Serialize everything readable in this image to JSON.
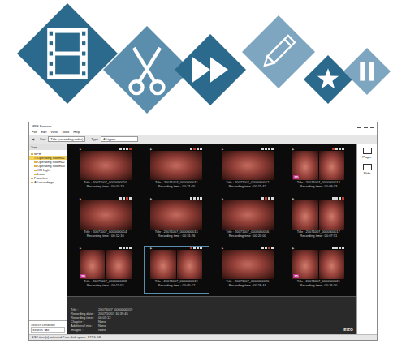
{
  "banner": {
    "icons": [
      {
        "kind": "film",
        "color": "#2b6a8c"
      },
      {
        "kind": "scissors",
        "color": "#5b8ead"
      },
      {
        "kind": "fast-forward",
        "color": "#2b6a8c"
      },
      {
        "kind": "pencil",
        "color": "#7fa6c1"
      },
      {
        "kind": "star",
        "color": "#2b6a8c"
      },
      {
        "kind": "pause",
        "color": "#7fa6c1"
      }
    ]
  },
  "window": {
    "title": "MPE Browser"
  },
  "menu": [
    "File",
    "Edit",
    "View",
    "Tools",
    "Help"
  ],
  "toolbar": {
    "back": "◀",
    "sort_label": "Sort",
    "sort_value": "Title (ascending order)",
    "filter_label": "Type",
    "filter_value": "All types"
  },
  "sidebar": {
    "header": "Tree",
    "items": [
      {
        "label": "MPE",
        "depth": 0,
        "selected": false
      },
      {
        "label": "Operating Room01",
        "depth": 1,
        "selected": true
      },
      {
        "label": "Operating Room02",
        "depth": 1,
        "selected": false
      },
      {
        "label": "Operating Room03",
        "depth": 1,
        "selected": false
      },
      {
        "label": "OR Light",
        "depth": 1,
        "selected": false
      },
      {
        "label": "Laser",
        "depth": 1,
        "selected": false
      },
      {
        "label": "Favorites",
        "depth": 0,
        "selected": false
      },
      {
        "label": "All recordings",
        "depth": 0,
        "selected": false
      }
    ],
    "search_label": "Search condition",
    "search_value": "Search : All"
  },
  "grid": {
    "marker": "▶",
    "thumbnails": [
      {
        "kind": "single",
        "badge": "",
        "selected": false,
        "title": "Title : 20071007_0000000010",
        "time": "Recording time : 00:07:18",
        "tags": [
          {
            "color": "#d9d9d9"
          },
          {
            "color": "#d9d9d9"
          },
          {
            "color": "#d9d9d9"
          },
          {
            "color": "#c0392b"
          }
        ]
      },
      {
        "kind": "single",
        "badge": "",
        "selected": false,
        "title": "Title : 20071007_0000000011",
        "time": "Recording time : 00:21:05",
        "tags": [
          {
            "color": "#d9d9d9"
          },
          {
            "color": "#c0392b"
          },
          {
            "color": "#d9d9d9"
          },
          {
            "color": "#d9d9d9"
          }
        ]
      },
      {
        "kind": "single",
        "badge": "",
        "selected": false,
        "title": "Title : 20071007_0000000012",
        "time": "Recording time : 00:15:42",
        "tags": [
          {
            "color": "#d9d9d9"
          },
          {
            "color": "#d9d9d9"
          },
          {
            "color": "#d9d9d9"
          },
          {
            "color": "#d9d9d9"
          }
        ]
      },
      {
        "kind": "dual",
        "badge": "3D",
        "selected": false,
        "title": "Title : 20071007_0000000013",
        "time": "Recording time : 00:09:33",
        "tags": [
          {
            "color": "#c0392b"
          },
          {
            "color": "#d9d9d9"
          },
          {
            "color": "#d9d9d9"
          },
          {
            "color": "#d9d9d9"
          }
        ]
      },
      {
        "kind": "single",
        "badge": "",
        "selected": false,
        "title": "Title : 20071007_0000000014",
        "time": "Recording time : 00:12:10",
        "tags": [
          {
            "color": "#d9d9d9"
          },
          {
            "color": "#d9d9d9"
          },
          {
            "color": "#c0392b"
          },
          {
            "color": "#d9d9d9"
          }
        ]
      },
      {
        "kind": "single",
        "badge": "",
        "selected": false,
        "title": "Title : 20071007_0000000015",
        "time": "Recording time : 00:31:26",
        "tags": [
          {
            "color": "#d9d9d9"
          },
          {
            "color": "#d9d9d9"
          },
          {
            "color": "#d9d9d9"
          },
          {
            "color": "#d9d9d9"
          }
        ]
      },
      {
        "kind": "single",
        "badge": "",
        "selected": false,
        "title": "Title : 20071007_0000000016",
        "time": "Recording time : 00:20:00",
        "tags": [
          {
            "color": "#d9d9d9"
          },
          {
            "color": "#c0392b"
          },
          {
            "color": "#d9d9d9"
          },
          {
            "color": "#d9d9d9"
          }
        ]
      },
      {
        "kind": "dual",
        "badge": "",
        "selected": false,
        "title": "Title : 20071007_0000000017",
        "time": "Recording time : 00:07:51",
        "tags": [
          {
            "color": "#d9d9d9"
          },
          {
            "color": "#d9d9d9"
          },
          {
            "color": "#d9d9d9"
          },
          {
            "color": "#c0392b"
          }
        ]
      },
      {
        "kind": "dual",
        "badge": "3D",
        "selected": false,
        "title": "Title : 20071007_0000000018",
        "time": "Recording time : 00:11:02",
        "tags": [
          {
            "color": "#d9d9d9"
          },
          {
            "color": "#d9d9d9"
          },
          {
            "color": "#d9d9d9"
          },
          {
            "color": "#d9d9d9"
          }
        ]
      },
      {
        "kind": "dual",
        "badge": "",
        "selected": true,
        "title": "Title : 20071007_0000000019",
        "time": "Recording time : 00:05:12",
        "tags": [
          {
            "color": "#c0392b"
          },
          {
            "color": "#d9d9d9"
          },
          {
            "color": "#d9d9d9"
          },
          {
            "color": "#d9d9d9"
          }
        ]
      },
      {
        "kind": "single",
        "badge": "",
        "selected": false,
        "title": "Title : 20071007_0000000020",
        "time": "Recording time : 00:18:44",
        "tags": [
          {
            "color": "#d9d9d9"
          },
          {
            "color": "#d9d9d9"
          },
          {
            "color": "#c0392b"
          },
          {
            "color": "#d9d9d9"
          }
        ]
      },
      {
        "kind": "dual",
        "badge": "3D",
        "selected": false,
        "title": "Title : 20071007_0000000021",
        "time": "Recording time : 00:26:30",
        "tags": [
          {
            "color": "#d9d9d9"
          },
          {
            "color": "#d9d9d9"
          },
          {
            "color": "#d9d9d9"
          },
          {
            "color": "#d9d9d9"
          }
        ]
      }
    ]
  },
  "info": [
    {
      "label": "Title :",
      "value": "20071007_0000000019"
    },
    {
      "label": "Recording date :",
      "value": "2007/10/07 10:39:45"
    },
    {
      "label": "Recording time :",
      "value": "00:05:12"
    },
    {
      "label": "Chapter :",
      "value": "None"
    },
    {
      "label": "Additional info :",
      "value": "None"
    },
    {
      "label": "Images :",
      "value": "None"
    }
  ],
  "right_panel": [
    {
      "kind": "player",
      "label": "Player"
    },
    {
      "kind": "slide",
      "label": "Slide"
    }
  ],
  "logo": "EIZO",
  "status_bar": "1/12 item(s) selected   Free disk space: 177.5 GB"
}
